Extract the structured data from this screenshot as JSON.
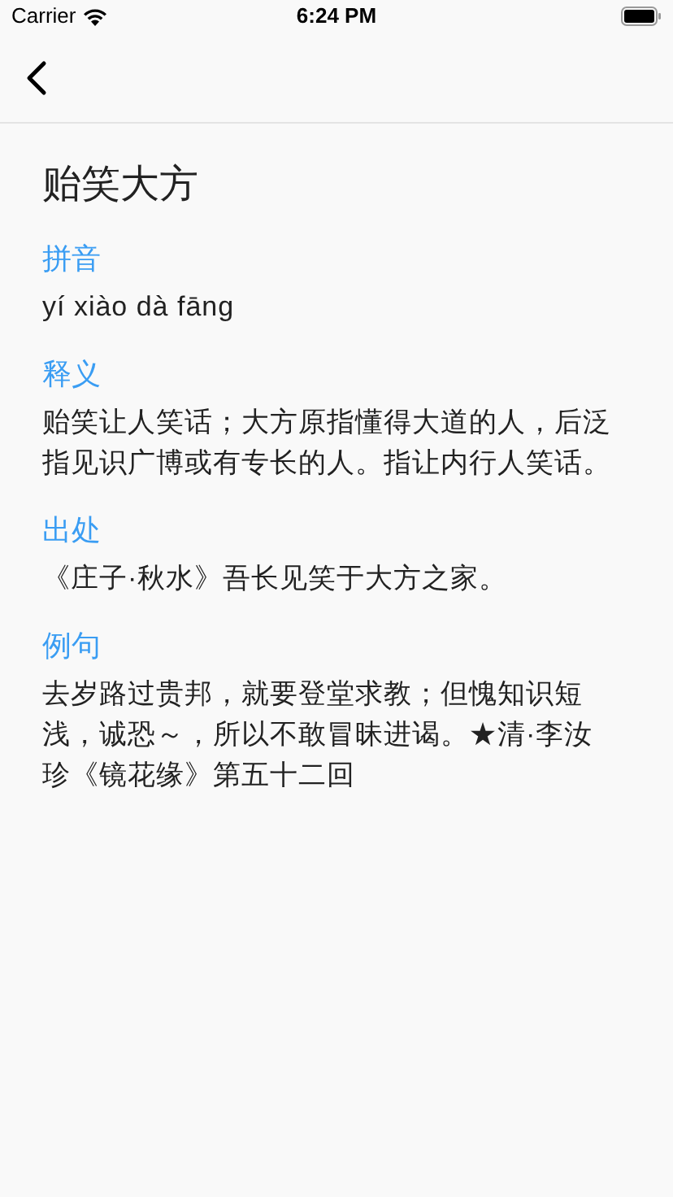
{
  "status_bar": {
    "carrier": "Carrier",
    "time": "6:24 PM"
  },
  "title": "贻笑大方",
  "sections": [
    {
      "label": "拼音",
      "text": "yí xiào dà fāng"
    },
    {
      "label": "释义",
      "text": "贻笑让人笑话；大方原指懂得大道的人，后泛指见识广博或有专长的人。指让内行人笑话。"
    },
    {
      "label": "出处",
      "text": "《庄子·秋水》吾长见笑于大方之家。"
    },
    {
      "label": "例句",
      "text": "去岁路过贵邦，就要登堂求教；但愧知识短浅，诚恐～，所以不敢冒昧进谒。★清·李汝珍《镜花缘》第五十二回"
    }
  ]
}
